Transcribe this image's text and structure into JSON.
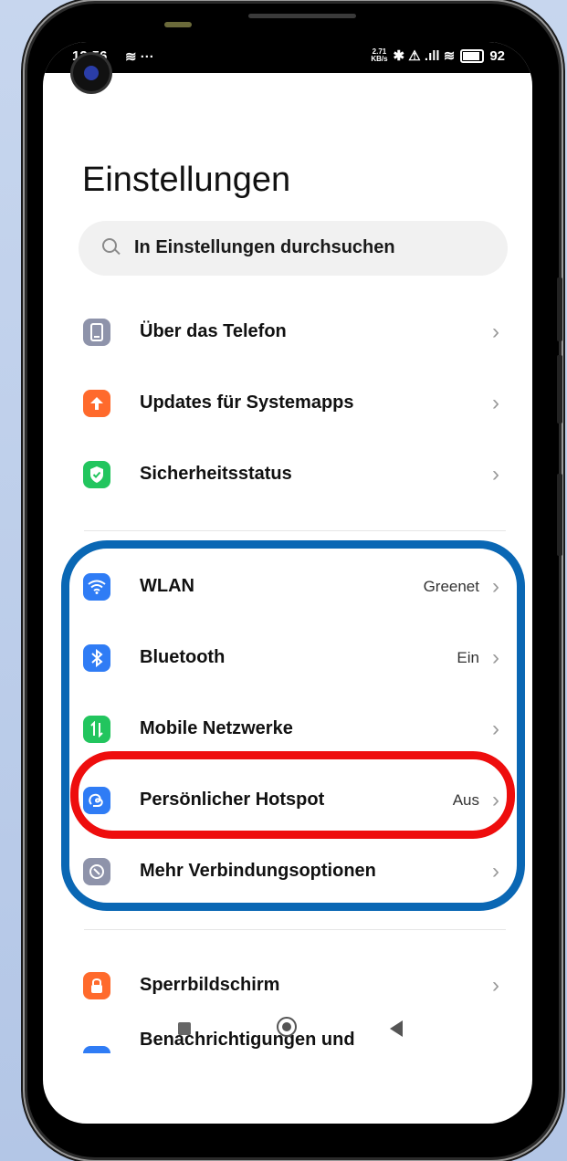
{
  "status": {
    "time": "12:56",
    "left_icons": "≋ ···",
    "speed_value": "2.71",
    "speed_unit": "KB/s",
    "right_icons": "✱ ⚠ .ıll ≋",
    "battery": "92"
  },
  "page": {
    "title": "Einstellungen",
    "search_placeholder": "In Einstellungen durchsuchen"
  },
  "items": [
    {
      "label": "Über das Telefon",
      "value": "",
      "icon": "phone-icon",
      "color": "#8e93aa"
    },
    {
      "label": "Updates für Systemapps",
      "value": "",
      "icon": "arrow-up-icon",
      "color": "#ff6a2c"
    },
    {
      "label": "Sicherheitsstatus",
      "value": "",
      "icon": "shield-check-icon",
      "color": "#22c55e"
    },
    {
      "label": "WLAN",
      "value": "Greenet",
      "icon": "wifi-icon",
      "color": "#2f7cf5"
    },
    {
      "label": "Bluetooth",
      "value": "Ein",
      "icon": "bluetooth-icon",
      "color": "#2f7cf5"
    },
    {
      "label": "Mobile Netzwerke",
      "value": "",
      "icon": "mobile-data-icon",
      "color": "#22c55e"
    },
    {
      "label": "Persönlicher Hotspot",
      "value": "Aus",
      "icon": "hotspot-icon",
      "color": "#2f7cf5"
    },
    {
      "label": "Mehr Verbindungsoptionen",
      "value": "",
      "icon": "link-icon",
      "color": "#8e93aa"
    },
    {
      "label": "Sperrbildschirm",
      "value": "",
      "icon": "lock-icon",
      "color": "#ff6a2c"
    },
    {
      "label": "Benachrichtigungen und",
      "value": "",
      "icon": "notification-icon",
      "color": "#2f7cf5"
    }
  ],
  "annotations": {
    "blue_frame_color": "#0a67b4",
    "red_frame_color": "#ee0d0d"
  }
}
